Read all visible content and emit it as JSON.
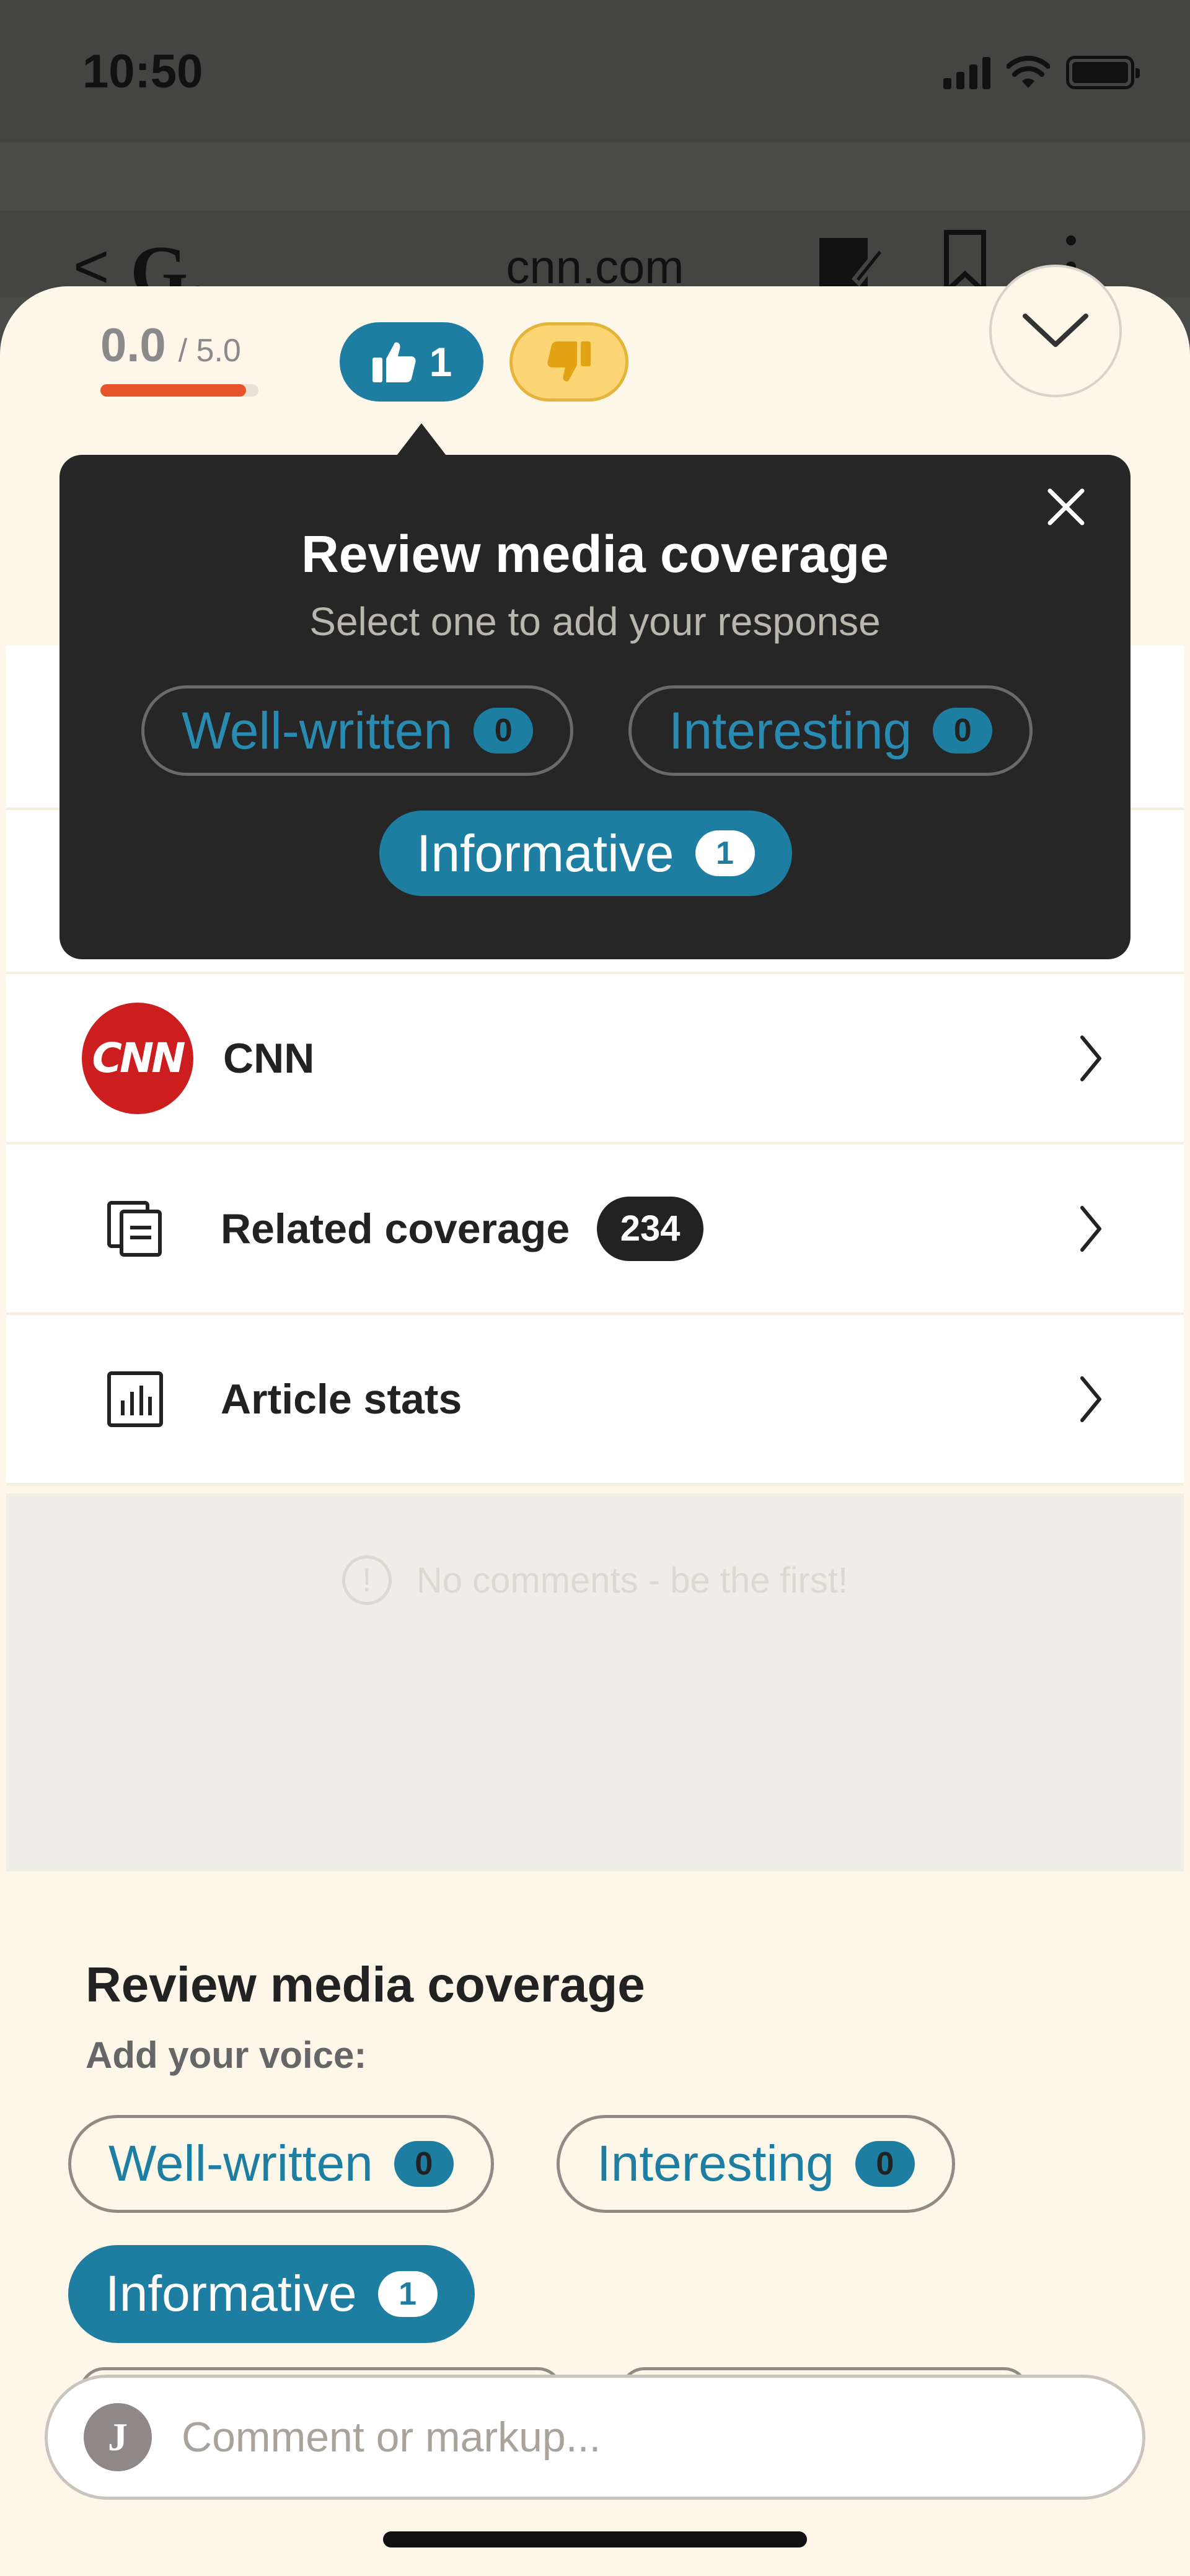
{
  "status_bar": {
    "time": "10:50"
  },
  "browser_header": {
    "back": "<",
    "logo": "G.",
    "domain": "cnn.com"
  },
  "sheet": {
    "rating": {
      "value": "0.0",
      "max": "/ 5.0",
      "fill_fraction": 0.92
    },
    "thumbs_up_count": "1"
  },
  "popover": {
    "title": "Review media coverage",
    "subtitle": "Select one to add your response",
    "chips": [
      {
        "label": "Well-written",
        "count": "0",
        "selected": false
      },
      {
        "label": "Interesting",
        "count": "0",
        "selected": false
      },
      {
        "label": "Informative",
        "count": "1",
        "selected": true
      }
    ]
  },
  "rows": [
    {
      "label": "CNN",
      "logo_text": "CNN",
      "icon": "cnn-logo"
    },
    {
      "label": "Related coverage",
      "badge": "234",
      "icon": "related-coverage-icon"
    },
    {
      "label": "Article stats",
      "icon": "bar-chart-icon"
    }
  ],
  "comments": {
    "empty_text": "No comments - be the first!"
  },
  "review_section": {
    "title": "Review media coverage",
    "subtitle": "Add your voice:",
    "chips": [
      {
        "label": "Well-written",
        "count": "0",
        "selected": false
      },
      {
        "label": "Interesting",
        "count": "0",
        "selected": false
      },
      {
        "label": "Informative",
        "count": "1",
        "selected": true
      }
    ]
  },
  "comment_bar": {
    "avatar_initial": "J",
    "placeholder": "Comment or markup..."
  },
  "colors": {
    "accent": "#1e7ea1",
    "rating_bar": "#e8542a",
    "thumbs_down": "#fcd675",
    "cnn_red": "#cc1e1e"
  }
}
